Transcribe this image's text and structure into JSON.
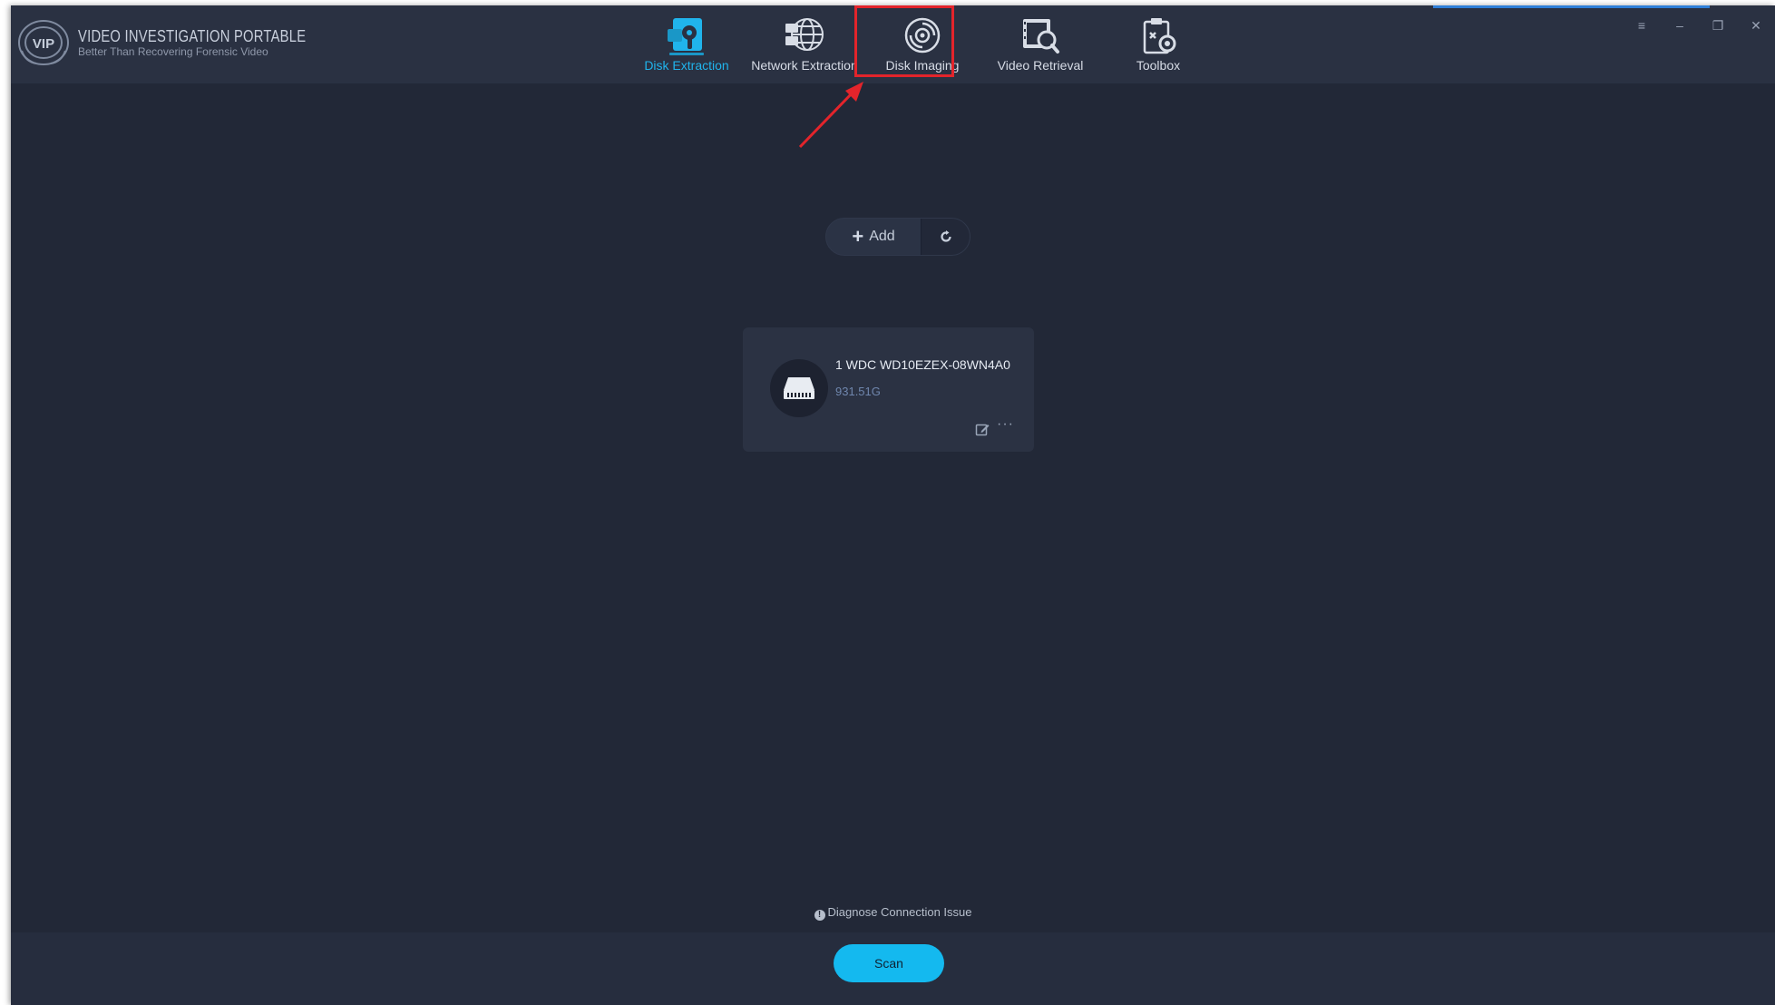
{
  "app": {
    "title": "VIDEO INVESTIGATION PORTABLE",
    "subtitle": "Better Than Recovering Forensic Video",
    "badge_text": "VIP"
  },
  "tabs": [
    {
      "label": "Disk Extraction",
      "icon": "disk-extraction-icon",
      "active": true
    },
    {
      "label": "Network Extraction",
      "icon": "network-extraction-icon",
      "active": false
    },
    {
      "label": "Disk Imaging",
      "icon": "disk-imaging-icon",
      "active": false,
      "highlighted": true
    },
    {
      "label": "Video Retrieval",
      "icon": "video-retrieval-icon",
      "active": false
    },
    {
      "label": "Toolbox",
      "icon": "toolbox-icon",
      "active": false
    }
  ],
  "window_controls": {
    "menu": "≡",
    "minimize": "–",
    "restore": "❐",
    "close": "✕"
  },
  "toolbar": {
    "add_label": "Add"
  },
  "disks": [
    {
      "name": "1 WDC WD10EZEX-08WN4A0",
      "size": "931.51G"
    }
  ],
  "diagnose_label": "Diagnose Connection Issue",
  "scan_label": "Scan",
  "colors": {
    "background": "#222837",
    "titlebar": "#2a3142",
    "accent": "#20b4ec",
    "highlight_box": "#e3242b",
    "scan_button": "#14b9ef"
  }
}
